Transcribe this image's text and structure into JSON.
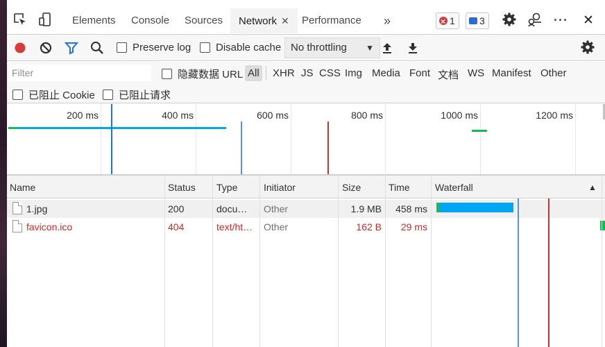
{
  "tabs": {
    "items": [
      "Elements",
      "Console",
      "Sources",
      "Network",
      "Performance"
    ],
    "active": "Network",
    "more": "»",
    "errors_count": "1",
    "messages_count": "3",
    "more_menu": "···",
    "close": "✕"
  },
  "toolbar": {
    "preserve_log": "Preserve log",
    "disable_cache": "Disable cache",
    "throttling": "No throttling"
  },
  "filter": {
    "placeholder": "Filter",
    "hide_data_urls": "隐藏数据 URL",
    "types": [
      "All",
      "XHR",
      "JS",
      "CSS",
      "Img",
      "Media",
      "Font",
      "文档",
      "WS",
      "Manifest",
      "Other"
    ],
    "blocked_cookies": "已阻止 Cookie",
    "blocked_requests": "已阻止请求"
  },
  "overview": {
    "ticks": [
      "200 ms",
      "400 ms",
      "600 ms",
      "800 ms",
      "1000 ms",
      "1200 ms"
    ]
  },
  "table": {
    "columns": [
      "Name",
      "Status",
      "Type",
      "Initiator",
      "Size",
      "Time",
      "Waterfall"
    ],
    "rows": [
      {
        "name": "1.jpg",
        "status": "200",
        "type": "docu…",
        "initiator": "Other",
        "size": "1.9 MB",
        "time": "458 ms",
        "error": false
      },
      {
        "name": "favicon.ico",
        "status": "404",
        "type": "text/ht…",
        "initiator": "Other",
        "size": "162 B",
        "time": "29 ms",
        "error": true
      }
    ]
  },
  "colors": {
    "record": "#d93b3b",
    "filter_active": "#1a73e8",
    "bar_blue": "#00a6f0",
    "bar_green": "#1db954",
    "dom_content_loaded": "#2a6bd6",
    "load_event": "#c83232",
    "error_text": "#d72727"
  }
}
